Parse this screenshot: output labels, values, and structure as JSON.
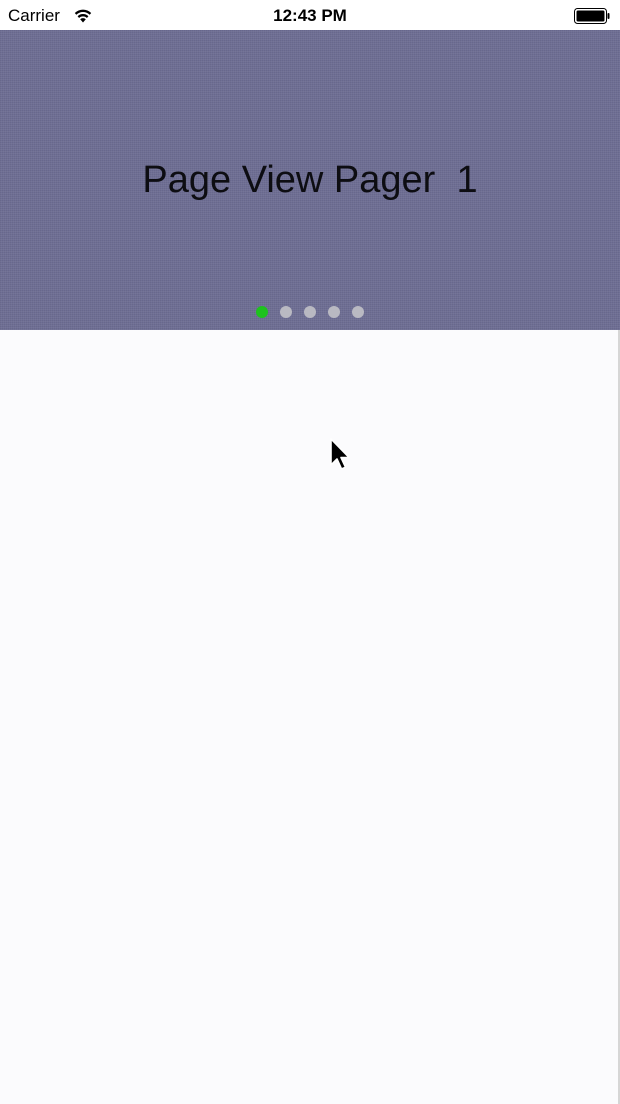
{
  "status_bar": {
    "carrier": "Carrier",
    "time": "12:43 PM"
  },
  "pager": {
    "title": "Page View Pager  1",
    "background_color": "#6e6e94",
    "page_count": 5,
    "current_page": 1,
    "active_dot_color": "#1ec21e",
    "inactive_dot_color": "#b9b9c2"
  },
  "icons": {
    "wifi": "wifi-icon",
    "battery": "battery-icon",
    "cursor": "mouse-cursor-icon"
  }
}
